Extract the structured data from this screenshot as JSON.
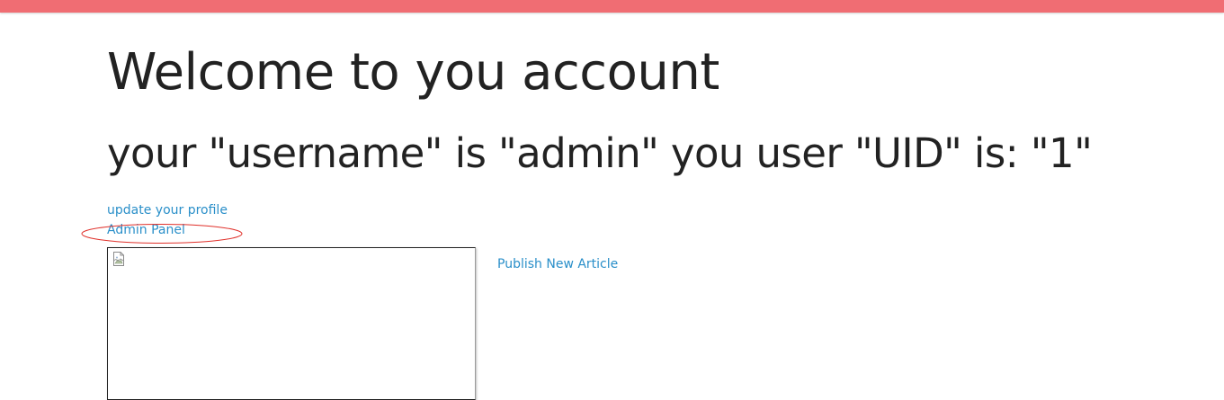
{
  "header": {
    "accent_color": "#f06d73"
  },
  "main": {
    "title": "Welcome to you account",
    "subtitle": "your \"username\" is \"admin\" you user \"UID\" is: \"1\"",
    "links": {
      "update_profile": "update your profile",
      "admin_panel": "Admin Panel",
      "publish_article": "Publish New Article"
    },
    "link_color": "#2a8fc9",
    "annotation_color": "#e0302a",
    "image": {
      "icon": "broken-image-icon"
    }
  }
}
